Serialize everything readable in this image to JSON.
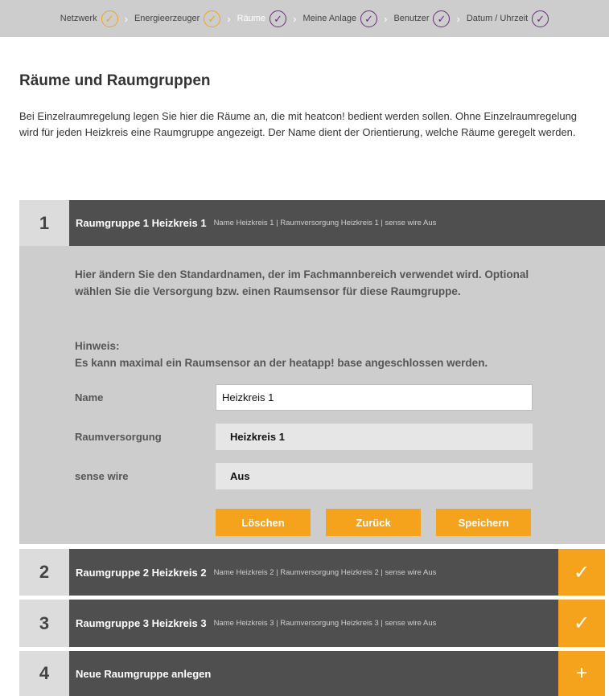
{
  "progress": {
    "steps": [
      {
        "label": "Netzwerk",
        "state": "done"
      },
      {
        "label": "Energieerzeuger",
        "state": "done"
      },
      {
        "label": "Räume",
        "state": "current"
      },
      {
        "label": "Meine Anlage",
        "state": "pending"
      },
      {
        "label": "Benutzer",
        "state": "pending"
      },
      {
        "label": "Datum / Uhrzeit",
        "state": "pending"
      }
    ],
    "check_glyph": "✓",
    "separator": "›"
  },
  "page": {
    "title": "Räume und Raumgruppen",
    "intro": "Bei Einzelraumregelung legen Sie hier die Räume an, die mit heatcon! bedient werden sollen. Ohne Einzelraumregelung wird für jeden Heizkreis eine Raumgruppe angezeigt. Der Name dient der Orientierung, welche Räume geregelt werden."
  },
  "groups": [
    {
      "number": "1",
      "title": "Raumgruppe 1 Heizkreis 1",
      "summary": "Name Heizkreis 1 | Raumversorgung Heizkreis 1 | sense wire Aus"
    },
    {
      "number": "2",
      "title": "Raumgruppe 2 Heizkreis 2",
      "summary": "Name Heizkreis 2 | Raumversorgung Heizkreis 2 | sense wire Aus",
      "action_icon": "✓"
    },
    {
      "number": "3",
      "title": "Raumgruppe 3 Heizkreis 3",
      "summary": "Name Heizkreis 3 | Raumversorgung Heizkreis 3 | sense wire Aus",
      "action_icon": "✓"
    },
    {
      "number": "4",
      "title": "Neue Raumgruppe anlegen",
      "action_icon": "+"
    }
  ],
  "editor": {
    "info": "Hier ändern Sie den Standardnamen, der im Fachmannbereich verwendet wird. Optional wählen Sie die Versorgung bzw. einen Raumsensor für diese Raumgruppe.",
    "hint_title": "Hinweis:",
    "hint_text": "Es kann maximal ein Raumsensor an der heatapp! base angeschlossen werden.",
    "name_label": "Name",
    "name_value": "Heizkreis 1",
    "supply_label": "Raumversorgung",
    "supply_value": "Heizkreis 1",
    "sensor_label": "sense wire",
    "sensor_value": "Aus",
    "delete_label": "Löschen",
    "back_label": "Zurück",
    "save_label": "Speichern"
  },
  "colors": {
    "accent": "#f5a21c",
    "header_dark": "#4f4f4f",
    "panel": "#cdcdcd",
    "step_ring": "#6b2a80"
  }
}
